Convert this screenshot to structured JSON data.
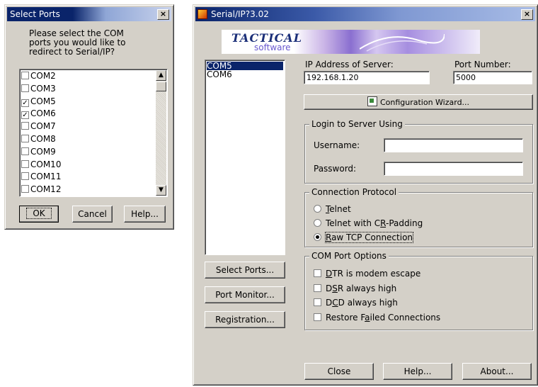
{
  "select_ports": {
    "title": "Select Ports",
    "close": "×",
    "prompt_line1": "Please select the COM",
    "prompt_line2": "ports you would like to",
    "prompt_line3": "redirect to Serial/IP?",
    "ports": [
      {
        "label": "COM2",
        "checked": false
      },
      {
        "label": "COM3",
        "checked": false
      },
      {
        "label": "COM5",
        "checked": true
      },
      {
        "label": "COM6",
        "checked": true
      },
      {
        "label": "COM7",
        "checked": false
      },
      {
        "label": "COM8",
        "checked": false
      },
      {
        "label": "COM9",
        "checked": false
      },
      {
        "label": "COM10",
        "checked": false
      },
      {
        "label": "COM11",
        "checked": false
      },
      {
        "label": "COM12",
        "checked": false
      }
    ],
    "ok_label": "OK",
    "cancel_label": "Cancel",
    "help_label": "Help..."
  },
  "serialip": {
    "title": "Serial/IP?3.02",
    "close": "×",
    "logo_top": "TACTICAL",
    "logo_bottom": "software",
    "port_list": [
      "COM5",
      "COM6"
    ],
    "ip_label": "IP Address of Server:",
    "ip_value": "192.168.1.20",
    "port_label": "Port Number:",
    "port_value": "5000",
    "wizard_label": "Configuration Wizard...",
    "login_group": "Login to Server Using",
    "username_label": "Username:",
    "username_value": "",
    "password_label": "Password:",
    "password_value": "",
    "protocol_group": "Connection Protocol",
    "protocols": [
      {
        "pre": "",
        "u": "T",
        "post": "elnet",
        "selected": false
      },
      {
        "pre": "Telnet with C",
        "u": "R",
        "post": "-Padding",
        "selected": false
      },
      {
        "pre": "",
        "u": "R",
        "post": "aw TCP Connection",
        "selected": true
      }
    ],
    "options_group": "COM Port Options",
    "options": [
      {
        "pre": "",
        "u": "D",
        "post": "TR is modem escape",
        "checked": false
      },
      {
        "pre": "D",
        "u": "S",
        "post": "R always high",
        "checked": false
      },
      {
        "pre": "D",
        "u": "C",
        "post": "D always high",
        "checked": false
      },
      {
        "pre": "Restore F",
        "u": "a",
        "post": "iled Connections",
        "checked": false
      }
    ],
    "select_ports_button": "Select Ports...",
    "port_monitor_button": "Port Monitor...",
    "registration_button": "Registration...",
    "close_button": "Close",
    "help_button": "Help...",
    "about_button": "About..."
  }
}
